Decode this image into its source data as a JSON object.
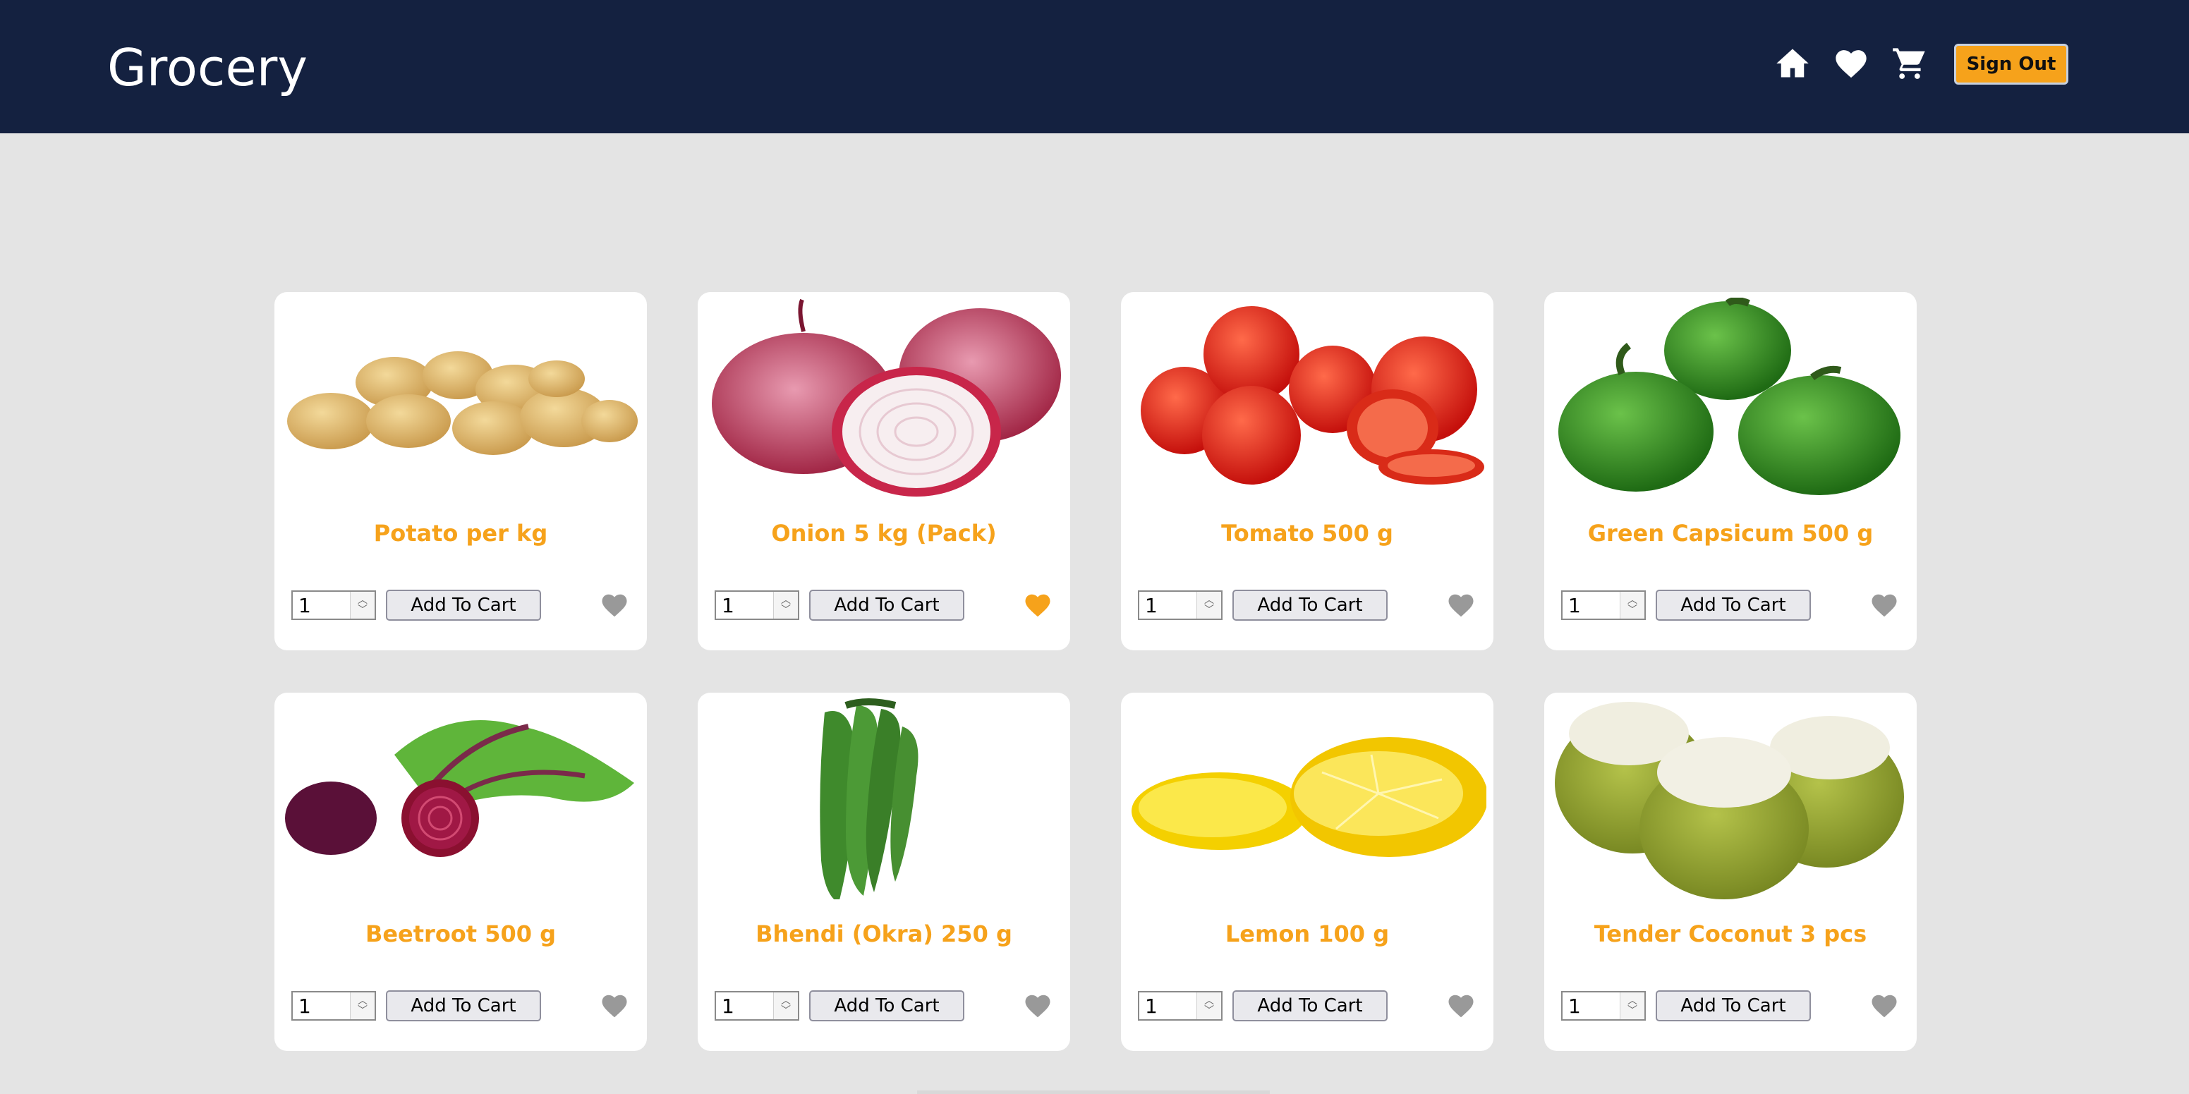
{
  "header": {
    "brand": "Grocery",
    "icons": [
      "home-icon",
      "heart-icon",
      "cart-icon"
    ],
    "sign_out_label": "Sign Out",
    "colors": {
      "background": "#142140",
      "accent": "#f6a21b"
    }
  },
  "products": [
    {
      "title": "Potato per kg",
      "qty": "1",
      "add_label": "Add To Cart",
      "favorite": false,
      "image": "potato"
    },
    {
      "title": "Onion 5 kg (Pack)",
      "qty": "1",
      "add_label": "Add To Cart",
      "favorite": true,
      "image": "onion"
    },
    {
      "title": "Tomato 500 g",
      "qty": "1",
      "add_label": "Add To Cart",
      "favorite": false,
      "image": "tomato"
    },
    {
      "title": "Green Capsicum 500 g",
      "qty": "1",
      "add_label": "Add To Cart",
      "favorite": false,
      "image": "capsicum"
    },
    {
      "title": "Beetroot 500 g",
      "qty": "1",
      "add_label": "Add To Cart",
      "favorite": false,
      "image": "beetroot"
    },
    {
      "title": "Bhendi (Okra) 250 g",
      "qty": "1",
      "add_label": "Add To Cart",
      "favorite": false,
      "image": "okra"
    },
    {
      "title": "Lemon 100 g",
      "qty": "1",
      "add_label": "Add To Cart",
      "favorite": false,
      "image": "lemon"
    },
    {
      "title": "Tender Coconut 3 pcs",
      "qty": "1",
      "add_label": "Add To Cart",
      "favorite": false,
      "image": "coconut"
    }
  ]
}
